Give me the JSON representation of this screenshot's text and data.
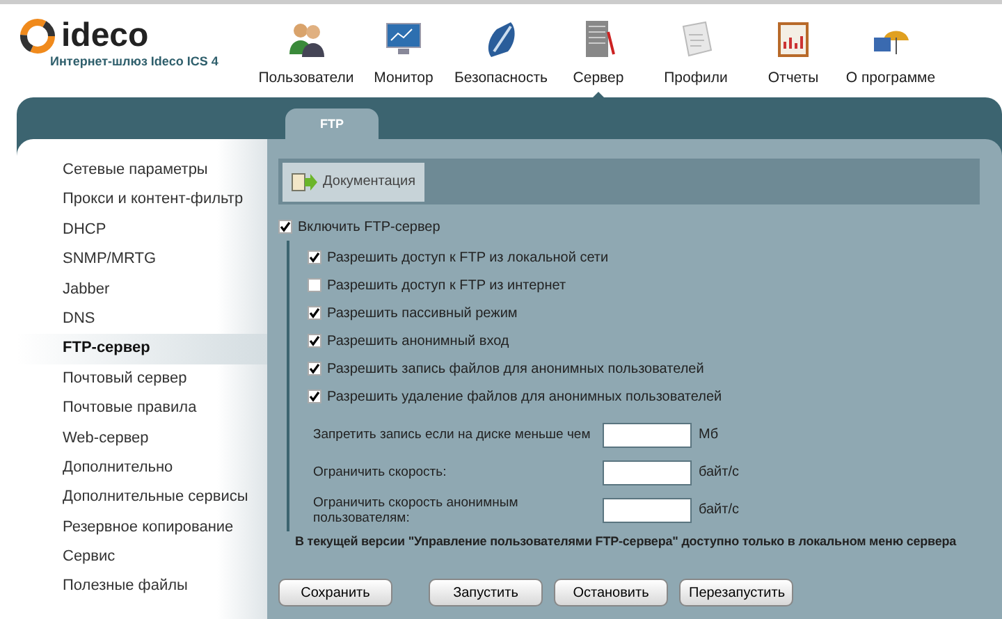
{
  "logo": {
    "name": "ideco",
    "subtitle": "Интернет-шлюз Ideco ICS 4"
  },
  "nav": [
    {
      "label": "Пользователи",
      "selected": false
    },
    {
      "label": "Монитор",
      "selected": false
    },
    {
      "label": "Безопасность",
      "selected": false
    },
    {
      "label": "Сервер",
      "selected": true
    },
    {
      "label": "Профили",
      "selected": false
    },
    {
      "label": "Отчеты",
      "selected": false
    },
    {
      "label": "О программе",
      "selected": false
    }
  ],
  "tabs": [
    {
      "label": "FTP",
      "selected": true
    }
  ],
  "sidebar": {
    "items": [
      {
        "label": "Сетевые параметры",
        "selected": false
      },
      {
        "label": "Прокси и контент-фильтр",
        "selected": false
      },
      {
        "label": "DHCP",
        "selected": false
      },
      {
        "label": "SNMP/MRTG",
        "selected": false
      },
      {
        "label": "Jabber",
        "selected": false
      },
      {
        "label": "DNS",
        "selected": false
      },
      {
        "label": "FTP-сервер",
        "selected": true
      },
      {
        "label": "Почтовый сервер",
        "selected": false
      },
      {
        "label": "Почтовые правила",
        "selected": false
      },
      {
        "label": "Web-сервер",
        "selected": false
      },
      {
        "label": "Дополнительно",
        "selected": false
      },
      {
        "label": "Дополнительные сервисы",
        "selected": false
      },
      {
        "label": "Резервное копирование",
        "selected": false
      },
      {
        "label": "Сервис",
        "selected": false
      },
      {
        "label": "Полезные файлы",
        "selected": false
      }
    ]
  },
  "toolbar": {
    "button": "Документация"
  },
  "enable": {
    "label": "Включить FTP-сервер",
    "checked": true
  },
  "options": [
    {
      "label": "Разрешить доступ к FTP из локальной сети",
      "checked": true
    },
    {
      "label": "Разрешить доступ к FTP из интернет",
      "checked": false
    },
    {
      "label": "Разрешить пассивный режим",
      "checked": true
    },
    {
      "label": "Разрешить анонимный вход",
      "checked": true
    },
    {
      "label": "Разрешить запись файлов для анонимных пользователей",
      "checked": true
    },
    {
      "label": "Разрешить удаление файлов для анонимных пользователей",
      "checked": true
    }
  ],
  "fields": [
    {
      "label": "Запретить запись если на диске меньше чем",
      "unit": "Мб"
    },
    {
      "label": "Ограничить скорость:",
      "unit": "байт/с"
    },
    {
      "label": "Ограничить скорость анонимным пользователям:",
      "unit": "байт/с"
    }
  ],
  "note": "В текущей версии \"Управление пользователями FTP-сервера\" доступно только в локальном меню сервера",
  "buttons": [
    "Сохранить",
    "Запустить",
    "Остановить",
    "Перезапустить"
  ]
}
